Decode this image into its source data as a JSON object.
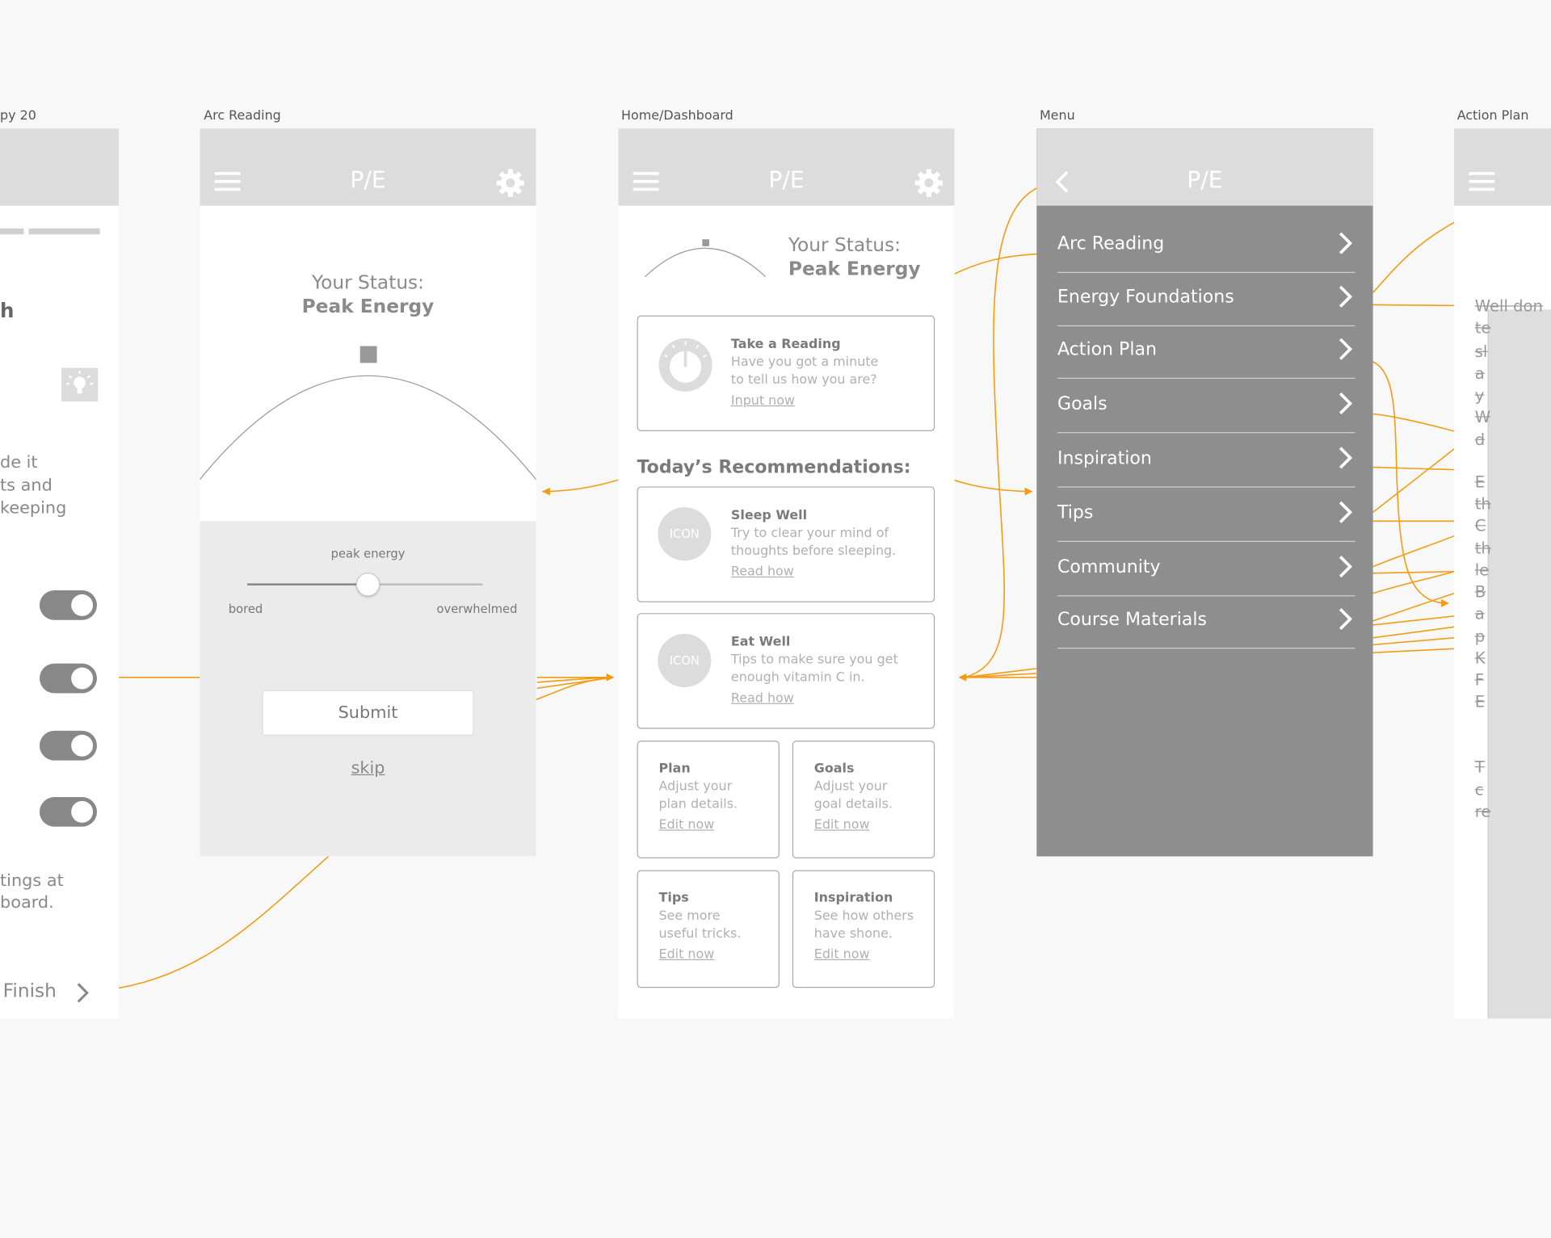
{
  "screens": {
    "copy": {
      "label": "py 20",
      "text1": "h",
      "para": [
        "de it",
        "ts and",
        "keeping"
      ],
      "bottom": [
        "tings at",
        "board."
      ],
      "finish": "Finish"
    },
    "arc": {
      "label": "Arc Reading",
      "logo": "P/E",
      "status_line1": "Your Status:",
      "status_line2": "Peak Energy",
      "slider_caption": "peak energy",
      "slider_left": "bored",
      "slider_right": "overwhelmed",
      "slider_value": 0.5,
      "submit": "Submit",
      "skip": "skip"
    },
    "home": {
      "label": "Home/Dashboard",
      "logo": "P/E",
      "status_line1": "Your Status:",
      "status_line2": "Peak Energy",
      "reading": {
        "title": "Take a Reading",
        "desc1": "Have you got a minute",
        "desc2": "to tell us how you are?",
        "link": "Input now"
      },
      "recommendations_title": "Today’s Recommendations:",
      "recs": [
        {
          "icon": "ICON",
          "title": "Sleep Well",
          "desc1": "Try to clear your mind of",
          "desc2": "thoughts before sleeping.",
          "link": "Read how"
        },
        {
          "icon": "ICON",
          "title": "Eat Well",
          "desc1": "Tips to make sure you get",
          "desc2": "enough vitamin C in.",
          "link": "Read how"
        }
      ],
      "tiles": [
        {
          "title": "Plan",
          "desc1": "Adjust your",
          "desc2": "plan details.",
          "link": "Edit now"
        },
        {
          "title": "Goals",
          "desc1": "Adjust your",
          "desc2": "goal details.",
          "link": "Edit now"
        },
        {
          "title": "Tips",
          "desc1": "See more",
          "desc2": "useful tricks.",
          "link": "Edit now"
        },
        {
          "title": "Inspiration",
          "desc1": "See how others",
          "desc2": "have shone.",
          "link": "Edit now"
        }
      ]
    },
    "menu": {
      "label": "Menu",
      "logo": "P/E",
      "items": [
        "Arc Reading",
        "Energy Foundations",
        "Action Plan",
        "Goals",
        "Inspiration",
        "Tips",
        "Community",
        "Course Materials"
      ]
    },
    "action": {
      "label": "Action Plan",
      "fragments": [
        "Well don",
        "te",
        "sl",
        "a",
        "y",
        "W",
        "d",
        "E",
        "th",
        "C",
        "th",
        "le",
        "B",
        "a",
        "p",
        "K",
        "F",
        "E",
        "T",
        "c",
        "re"
      ]
    }
  },
  "colors": {
    "connector": "#f39c12",
    "header": "#dcdcdc",
    "menu_bg": "#8e8e8e",
    "panel": "#ebebeb"
  }
}
